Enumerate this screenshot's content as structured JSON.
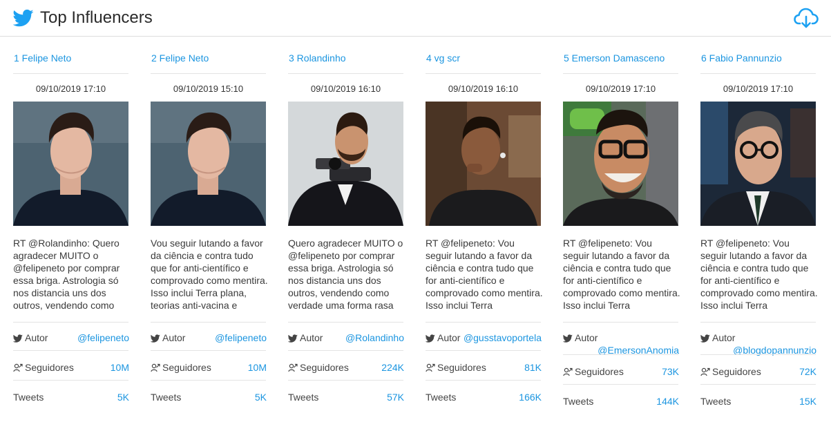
{
  "header": {
    "title": "Top Influencers",
    "brand_icon": "twitter-bird-icon",
    "download_icon": "cloud-download-icon",
    "accent_color": "#1b95e0"
  },
  "labels": {
    "autor": "Autor",
    "seguidores": "Seguidores",
    "tweets": "Tweets"
  },
  "cards": [
    {
      "name": "1 Felipe Neto",
      "date": "09/10/2019 17:10",
      "tweet": "RT @Rolandinho: Quero agradecer MUITO o @felipeneto por comprar essa briga. Astrologia só nos distancia uns dos outros, vendendo como",
      "handle": "@felipeneto",
      "followers": "10M",
      "tweets": "5K"
    },
    {
      "name": "2 Felipe Neto",
      "date": "09/10/2019 15:10",
      "tweet": "Vou seguir lutando a favor da ciência e contra tudo que for anti-científico e comprovado como mentira. Isso inclui Terra plana, teorias anti-vacina e",
      "handle": "@felipeneto",
      "followers": "10M",
      "tweets": "5K"
    },
    {
      "name": "3 Rolandinho",
      "date": "09/10/2019 16:10",
      "tweet": "Quero agradecer MUITO o @felipeneto por comprar essa briga. Astrologia só nos distancia uns dos outros, vendendo como verdade uma forma rasa",
      "handle": "@Rolandinho",
      "followers": "224K",
      "tweets": "57K"
    },
    {
      "name": "4 vg scr",
      "date": "09/10/2019 16:10",
      "tweet": "RT @felipeneto: Vou seguir lutando a favor da ciência e contra tudo que for anti-científico e comprovado como mentira. Isso inclui Terra",
      "handle": "@gusstavoportela",
      "followers": "81K",
      "tweets": "166K"
    },
    {
      "name": "5 Emerson Damasceno",
      "date": "09/10/2019 17:10",
      "tweet": "RT @felipeneto: Vou seguir lutando a favor da ciência e contra tudo que for anti-científico e comprovado como mentira. Isso inclui Terra",
      "handle": "@EmersonAnomia",
      "followers": "73K",
      "tweets": "144K"
    },
    {
      "name": "6 Fabio Pannunzio",
      "date": "09/10/2019 17:10",
      "tweet": "RT @felipeneto: Vou seguir lutando a favor da ciência e contra tudo que for anti-científico e comprovado como mentira. Isso inclui Terra",
      "handle": "@blogdopannunzio",
      "followers": "72K",
      "tweets": "15K"
    }
  ]
}
